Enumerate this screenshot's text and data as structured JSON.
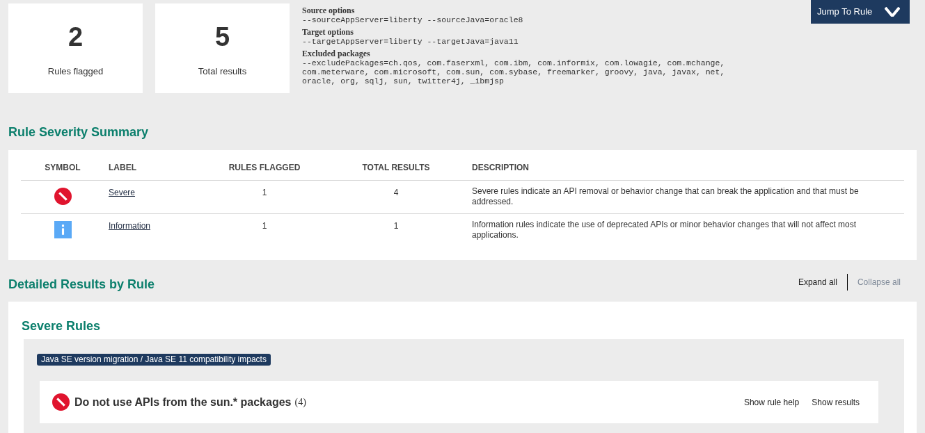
{
  "stats": [
    {
      "value": "2",
      "label": "Rules flagged"
    },
    {
      "value": "5",
      "label": "Total results"
    }
  ],
  "options": [
    {
      "heading": "Source options",
      "value": "--sourceAppServer=liberty --sourceJava=oracle8"
    },
    {
      "heading": "Target options",
      "value": "--targetAppServer=liberty --targetJava=java11"
    },
    {
      "heading": "Excluded packages",
      "value": "--excludePackages=ch.qos, com.faserxml, com.ibm, com.informix, com.lowagie, com.mchange, com.meterware, com.microsoft, com.sun, com.sybase, freemarker, groovy, java, javax, net, oracle, org, sqlj, sun, twitter4j, _ibmjsp"
    }
  ],
  "jump_button": "Jump To Rule",
  "summary": {
    "title": "Rule Severity Summary",
    "columns": [
      "SYMBOL",
      "LABEL",
      "RULES FLAGGED",
      "TOTAL RESULTS",
      "DESCRIPTION"
    ],
    "rows": [
      {
        "kind": "severe",
        "label": "Severe",
        "rules_flagged": "1",
        "total_results": "4",
        "description": "Severe rules indicate an API removal or behavior change that can break the application and that must be addressed."
      },
      {
        "kind": "info",
        "label": "Information",
        "rules_flagged": "1",
        "total_results": "1",
        "description": "Information rules indicate the use of deprecated APIs or minor behavior changes that will not affect most applications."
      }
    ]
  },
  "details": {
    "title": "Detailed Results by Rule",
    "links": [
      {
        "label": "Expand all",
        "disabled": false
      },
      {
        "label": "Collapse all",
        "disabled": true
      }
    ],
    "section_title": "Severe Rules",
    "tag": "Java SE version migration / Java SE 11 compatibility impacts",
    "rules": [
      {
        "kind": "severe",
        "title": "Do not use APIs from the sun.* packages",
        "count": "(4)",
        "actions": [
          "Show rule help",
          "Show results"
        ]
      }
    ]
  }
}
